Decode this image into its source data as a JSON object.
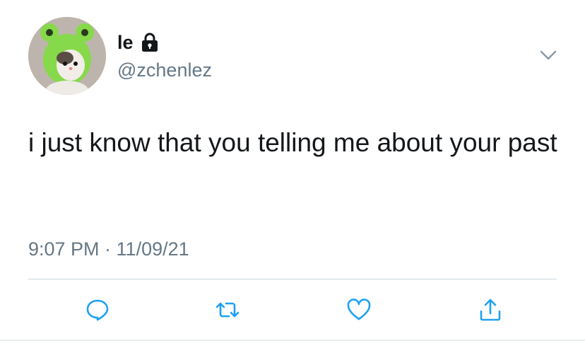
{
  "author": {
    "display_name": "le",
    "handle": "@zchenlez",
    "protected": true,
    "avatar_icon": "avatar-cat-frog-hat"
  },
  "tweet": {
    "text": "i just know that you telling me about your past",
    "timestamp": "9:07 PM · 11/09/21"
  },
  "actions": [
    "reply-icon",
    "retweet-icon",
    "like-icon",
    "share-icon"
  ],
  "colors": {
    "text": "#14171a",
    "secondary": "#657786",
    "icon": "#1da1f2"
  }
}
